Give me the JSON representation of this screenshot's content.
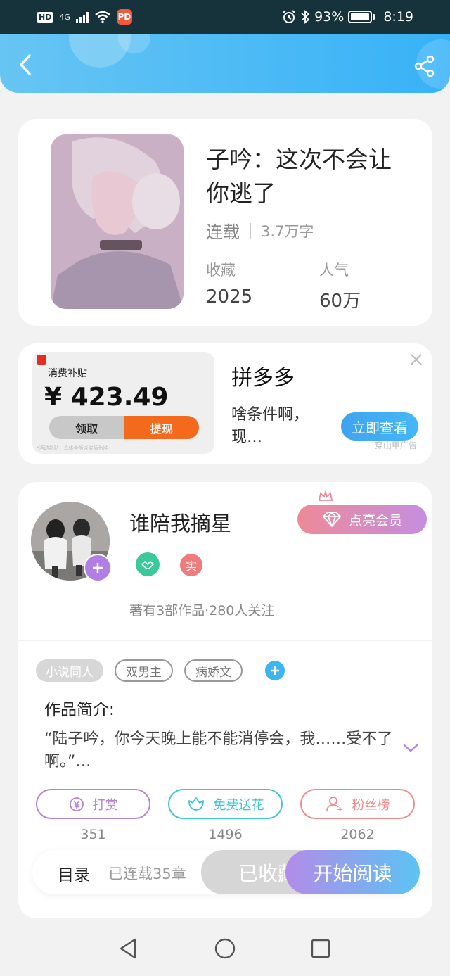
{
  "status_bar": {
    "left_badge": "HD",
    "signal": "4G",
    "app_icon_label": "PD",
    "battery": "93%",
    "time": "8:19"
  },
  "header": {
    "back_icon": "chevron-left-icon",
    "share_icon": "share-icon"
  },
  "book": {
    "title": "子吟：这次不会让你逃了",
    "status": "连载",
    "word_count": "3.7万字",
    "favorites_label": "收藏",
    "favorites_value": "2025",
    "popularity_label": "人气",
    "popularity_value": "60万"
  },
  "ad": {
    "coupon_label": "消费补贴",
    "amount": "¥ 423.49",
    "claim_button": "领取",
    "withdraw_button": "提现",
    "fine_print": "*活动补贴，具体金额以实际为准",
    "title": "拼多多",
    "description": "啥条件啊，现…",
    "cta": "立即查看",
    "mini_text": "穿山甲广告",
    "brand_color": "#e02e24"
  },
  "author": {
    "name": "谁陪我摘星",
    "real_badge": "实",
    "vip_button": "点亮会员",
    "meta": "著有3部作品·280人关注"
  },
  "tags": [
    {
      "label": "小说同人",
      "style": "filled"
    },
    {
      "label": "双男主",
      "style": "outline"
    },
    {
      "label": "病娇文",
      "style": "outline"
    }
  ],
  "intro": {
    "label": "作品简介:",
    "text": "“陆子吟，你今天晚上能不能消停会，我……受不了啊。”…"
  },
  "actions": [
    {
      "label": "打赏",
      "count": "351",
      "color": "#b384d9",
      "icon": "yen-coin-icon"
    },
    {
      "label": "免费送花",
      "count": "1496",
      "color": "#3fc3d6",
      "icon": "flower-icon"
    },
    {
      "label": "粉丝榜",
      "count": "2062",
      "color": "#ef8a8a",
      "icon": "user-icon"
    }
  ],
  "bottom_bar": {
    "catalog": "目录",
    "chapters": "已连载35章",
    "collected": "已收藏",
    "read": "开始阅读"
  }
}
